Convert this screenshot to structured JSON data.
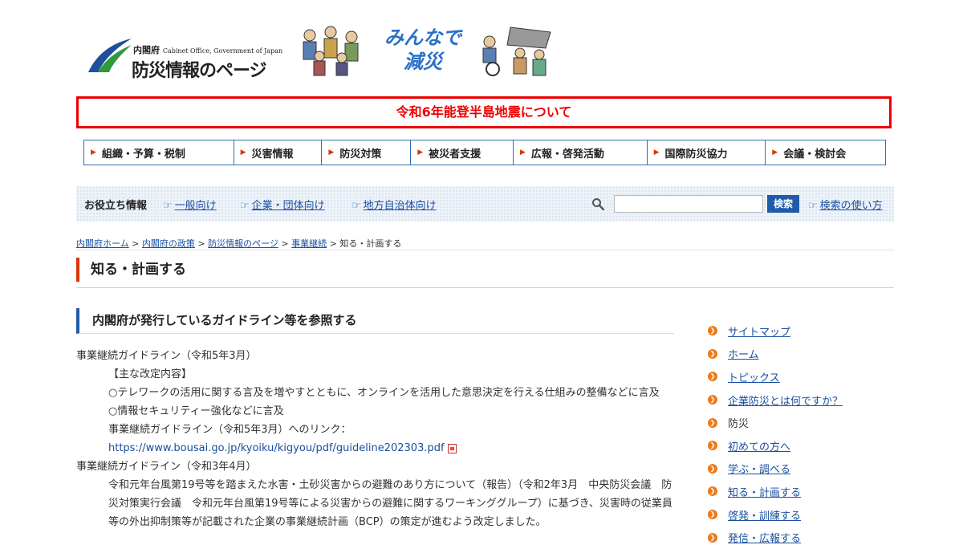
{
  "header": {
    "org_jp": "内閣府",
    "org_en": "Cabinet Office, Government of Japan",
    "site_title": "防災情報のページ",
    "slogan_line1": "みんなで",
    "slogan_line2": "減災"
  },
  "banner": {
    "text": "令和6年能登半島地震について",
    "color": "#e00000"
  },
  "gnav": {
    "items": [
      {
        "label": "組織・予算・税制"
      },
      {
        "label": "災害情報"
      },
      {
        "label": "防災対策"
      },
      {
        "label": "被災者支援"
      },
      {
        "label": "広報・啓発活動"
      },
      {
        "label": "国際防災協力"
      },
      {
        "label": "会議・検討会"
      }
    ]
  },
  "useful": {
    "label": "お役立ち情報",
    "links": [
      {
        "label": "一般向け"
      },
      {
        "label": "企業・団体向け"
      },
      {
        "label": "地方自治体向け"
      }
    ]
  },
  "search": {
    "value": "",
    "placeholder": "",
    "button_label": "検索",
    "howto_label": "検索の使い方"
  },
  "breadcrumb": {
    "items": [
      {
        "label": "内閣府ホーム"
      },
      {
        "label": "内閣府の政策"
      },
      {
        "label": "防災情報のページ"
      },
      {
        "label": "事業継続"
      }
    ],
    "separator": ">",
    "current": "知る・計画する"
  },
  "page_title": "知る・計画する",
  "section": {
    "title": "内閣府が発行しているガイドライン等を参照する",
    "items": [
      {
        "title": "事業継続ガイドライン（令和5年3月）",
        "sub_heading": "【主な改定内容】",
        "points": [
          "○テレワークの活用に関する言及を増やすとともに、オンラインを活用した意思決定を行える仕組みの整備などに言及",
          "○情報セキュリティー強化などに言及"
        ],
        "link_intro": "事業継続ガイドライン（令和5年3月）へのリンク：",
        "link_url": "https://www.bousai.go.jp/kyoiku/kigyou/pdf/guideline202303.pdf"
      },
      {
        "title": "事業継続ガイドライン（令和3年4月）",
        "body": "令和元年台風第19号等を踏まえた水害・土砂災害からの避難のあり方について（報告）（令和2年3月　中央防災会議　防災対策実行会議　令和元年台風第19号等による災害からの避難に関するワーキンググループ）に基づき、災害時の従業員等の外出抑制策等が記載された企業の事業継続計画（BCP）の策定が進むよう改定しました。"
      }
    ]
  },
  "sidenav": {
    "items": [
      {
        "label": "サイトマップ"
      },
      {
        "label": "ホーム"
      },
      {
        "label": "トピックス"
      },
      {
        "label": "企業防災とは何ですか？"
      },
      {
        "label": "防災"
      },
      {
        "label": "初めての方へ"
      },
      {
        "label": "学ぶ・調べる"
      },
      {
        "label": "知る・計画する"
      },
      {
        "label": "啓発・訓練する"
      },
      {
        "label": "発信・広報する"
      }
    ]
  },
  "colors": {
    "accent_orange": "#d9360c",
    "nav_blue": "#2f6fb5",
    "link_blue": "#1a4fa0",
    "bullet_orange": "#ee7a1a"
  }
}
